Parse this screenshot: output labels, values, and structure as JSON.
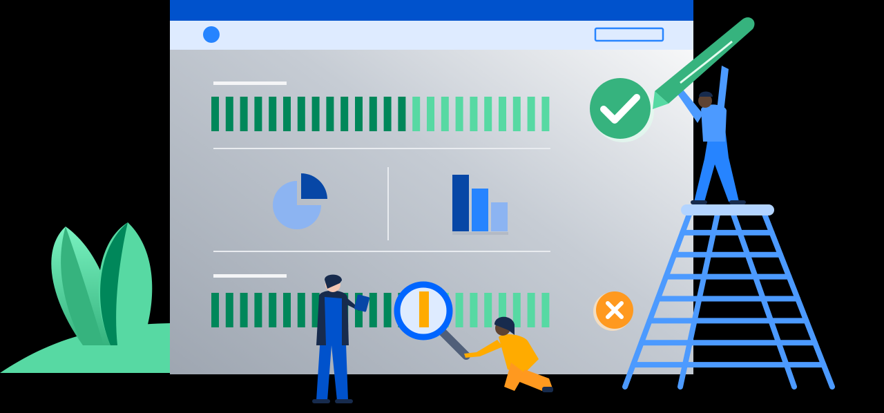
{
  "colors": {
    "background": "#000000",
    "browser_top_bar": "#0052CC",
    "browser_address_bar": "#DEEBFF",
    "browser_dot": "#2684FF",
    "green_dark": "#00875A",
    "green_light": "#57D9A3",
    "blue_dark": "#0747A6",
    "blue_mid": "#2684FF",
    "blue_light": "#8CB4F2",
    "success": "#36B37E",
    "error": "#FF991F",
    "person_blue": "#0052CC",
    "person_yellow": "#FFAB00",
    "ladder_blue": "#4C9AFF"
  },
  "icons": {
    "check": "check-icon",
    "close": "close-icon",
    "magnifier": "magnifier-icon",
    "pie": "pie-chart-icon",
    "bars": "bar-chart-icon",
    "pen": "pen-icon"
  },
  "illustration": {
    "stripe_rows": 2,
    "stripes_per_row": 24,
    "bar_chart_levels": [
      0.82,
      0.62,
      0.42
    ]
  }
}
